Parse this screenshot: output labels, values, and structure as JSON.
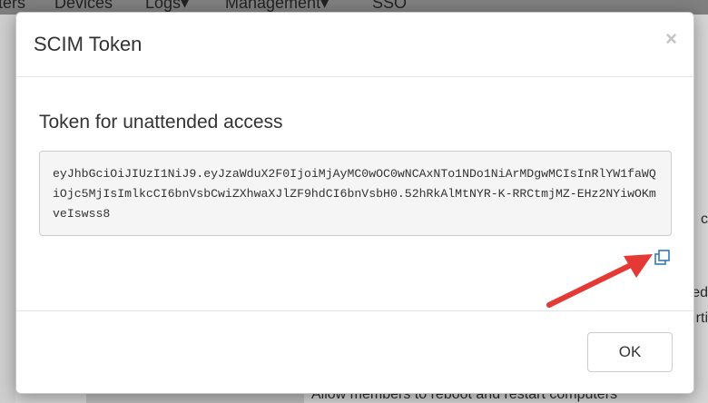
{
  "background": {
    "nav_items": [
      "ters",
      "Devices",
      "Logs",
      "Management",
      "SSO"
    ],
    "right_fragments": [
      "c",
      "ed",
      "rti"
    ],
    "bottom_text": "Allow members to reboot and restart computers"
  },
  "modal": {
    "title": "SCIM Token",
    "close_label": "×",
    "section_heading": "Token for unattended access",
    "token": "eyJhbGciOiJIUzI1NiJ9.eyJzaWduX2F0IjoiMjAyMC0wOC0wNCAxNTo1NDo1NiArMDgwMCIsInRlYW1faWQiOjc5MjIsImlkcCI6bnVsbCwiZXhwaXJlZF9hdCI6bnVsbH0.52hRkAlMtNYR-K-RRCtmjMZ-EHz2NYiwOKmveIswss8",
    "copy_icon": "copy-icon",
    "ok_label": "OK"
  },
  "colors": {
    "accent": "#337ab7",
    "annotation": "#e53935"
  }
}
